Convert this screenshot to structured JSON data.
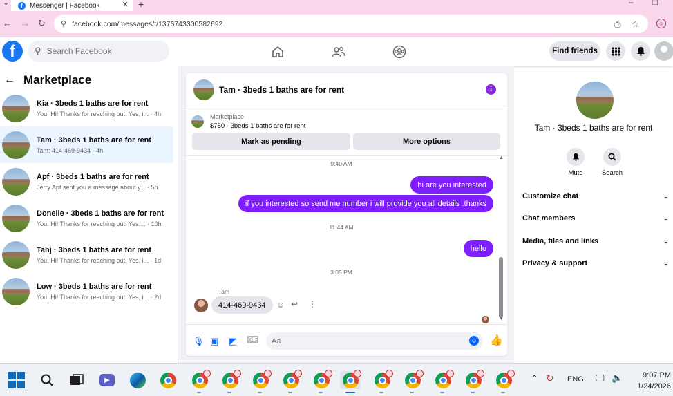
{
  "browser": {
    "tab_title": "Messenger | Facebook",
    "tab_favicon_letter": "f",
    "tab_close": "✕",
    "new_tab": "+",
    "url_host": "facebook.com",
    "url_path": "/messages/t/1376743300582692",
    "profile_initial": "☺"
  },
  "fb_header": {
    "logo_letter": "f",
    "search_placeholder": "Search Facebook",
    "find_friends_label": "Find friends",
    "nav_icons": [
      "home-icon",
      "friends-icon",
      "groups-icon"
    ],
    "right_icons": [
      "menu-grid-icon",
      "notifications-bell-icon",
      "account-avatar"
    ]
  },
  "sidebar": {
    "title": "Marketplace",
    "back_glyph": "←",
    "conversations": [
      {
        "name": "Kia · 3beds 1 baths are for rent",
        "snippet": "You: Hi! Thanks for reaching out. Yes, i...",
        "time": "· 4h",
        "active": false
      },
      {
        "name": "Tam · 3beds 1 baths are for rent",
        "snippet": "Tam: 414-469-9434",
        "time": "· 4h",
        "active": true
      },
      {
        "name": "Apf · 3beds 1 baths are for rent",
        "snippet": "Jerry Apf sent you a message about y...",
        "time": "· 5h",
        "active": false
      },
      {
        "name": "Donelle · 3beds 1 baths are for rent",
        "snippet": "You: Hi! Thanks for reaching out. Yes,...",
        "time": "· 10h",
        "active": false
      },
      {
        "name": "Tahj · 3beds 1 baths are for rent",
        "snippet": "You: Hi! Thanks for reaching out. Yes, i...",
        "time": "· 1d",
        "active": false
      },
      {
        "name": "Low · 3beds 1 baths are for rent",
        "snippet": "You: Hi! Thanks for reaching out. Yes, i...",
        "time": "· 2d",
        "active": false
      }
    ]
  },
  "chat": {
    "title": "Tam · 3beds 1 baths are for rent",
    "info_glyph": "i",
    "marketplace_label": "Marketplace",
    "listing": "$750 - 3beds 1 baths are for rent",
    "mark_pending_label": "Mark as pending",
    "more_options_label": "More options",
    "messages": {
      "time1": "9:40 AM",
      "out1": "hi are you interested",
      "out2": "if you interested so send me number i will provide you all details .thanks",
      "time2": "11:44 AM",
      "out3": "hello",
      "time3": "3:05 PM",
      "in_sender": "Tam",
      "in1": "414-469-9434"
    },
    "composer_placeholder": "Aa"
  },
  "right_panel": {
    "name": "Tam · 3beds 1 baths are for rent",
    "actions": [
      {
        "label": "Mute",
        "icon": "bell-icon"
      },
      {
        "label": "Search",
        "icon": "search-icon"
      }
    ],
    "sections": [
      "Customize chat",
      "Chat members",
      "Media, files and links",
      "Privacy & support"
    ]
  },
  "taskbar": {
    "language": "ENG",
    "time": "9:07 PM",
    "date": "1/24/2026"
  }
}
